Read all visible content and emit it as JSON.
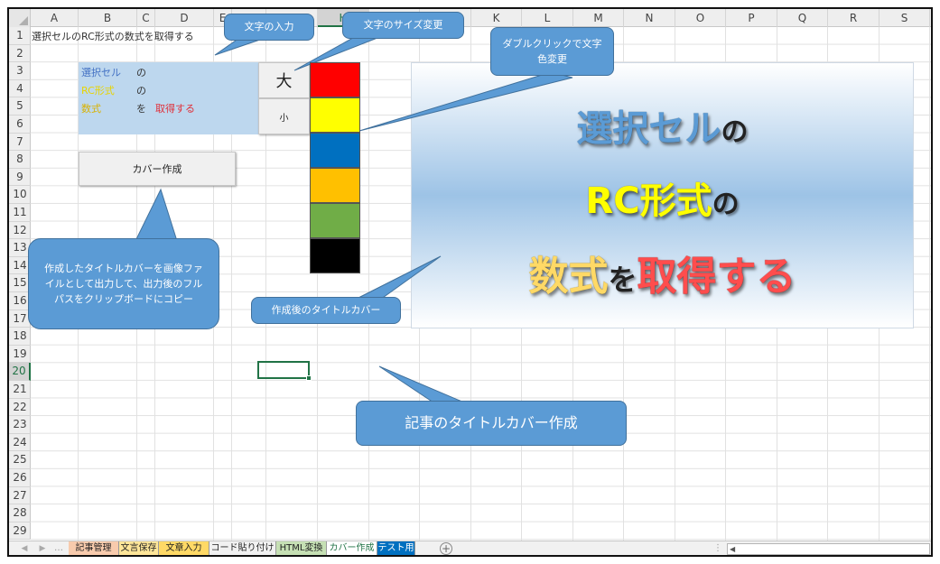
{
  "sheet": {
    "columns": [
      "A",
      "B",
      "C",
      "D",
      "E",
      "F",
      "G",
      "H",
      "I",
      "J",
      "K",
      "L",
      "M",
      "N",
      "O",
      "P",
      "Q",
      "R",
      "S"
    ],
    "rows": [
      "1",
      "2",
      "3",
      "4",
      "5",
      "6",
      "7",
      "8",
      "9",
      "10",
      "11",
      "12",
      "13",
      "14",
      "15",
      "16",
      "17",
      "18",
      "19",
      "20",
      "21",
      "22",
      "23",
      "24",
      "25",
      "26",
      "27",
      "28",
      "29"
    ],
    "selected_column": "H",
    "selected_row": "20",
    "a1_text": "選択セルのRC形式の数式を取得する"
  },
  "text_panel": {
    "line1": "選択セル",
    "line1_suffix": "の",
    "line2": "RC形式",
    "line2_suffix": "の",
    "line3": "数式",
    "line3_suffix": "を",
    "line3_tail": "取得する"
  },
  "controls": {
    "large_label": "大",
    "small_label": "小",
    "create_cover_label": "カバー作成"
  },
  "swatches": [
    "#ff0000",
    "#ffff00",
    "#0070c0",
    "#ffc000",
    "#70ad47",
    "#000000"
  ],
  "preview": {
    "line1_main": "選択セル",
    "line1_suffix": "の",
    "line2_main": "RC形式",
    "line2_suffix": "の",
    "line3_a": "数式",
    "line3_b": "を",
    "line3_c": "取得する"
  },
  "callouts": {
    "text_input": "文字の入力",
    "size_change": "文字のサイズ変更",
    "color_change": "ダブルクリックで文字色変更",
    "export_info": "作成したタイトルカバーを画像ファイルとして出力して、出力後のフルパスをクリップボードにコピー",
    "cover_after": "作成後のタイトルカバー",
    "main_title": "記事のタイトルカバー作成"
  },
  "tabs": [
    {
      "label": "記事管理",
      "color": "#f8cbad"
    },
    {
      "label": "文言保存",
      "color": "#ffe699"
    },
    {
      "label": "文章入力",
      "color": "#ffd966"
    },
    {
      "label": "コード貼り付け",
      "color": "#f1f1f1"
    },
    {
      "label": "HTML変換",
      "color": "#c6e0b4"
    },
    {
      "label": "カバー作成",
      "color": "#ffffff"
    },
    {
      "label": "テスト用",
      "color": "#0070c0"
    }
  ],
  "active_tab": "カバー作成",
  "colors": {
    "excel_green": "#217346",
    "callout_blue": "#5b9bd5",
    "panel_blue": "#bdd7ee"
  }
}
